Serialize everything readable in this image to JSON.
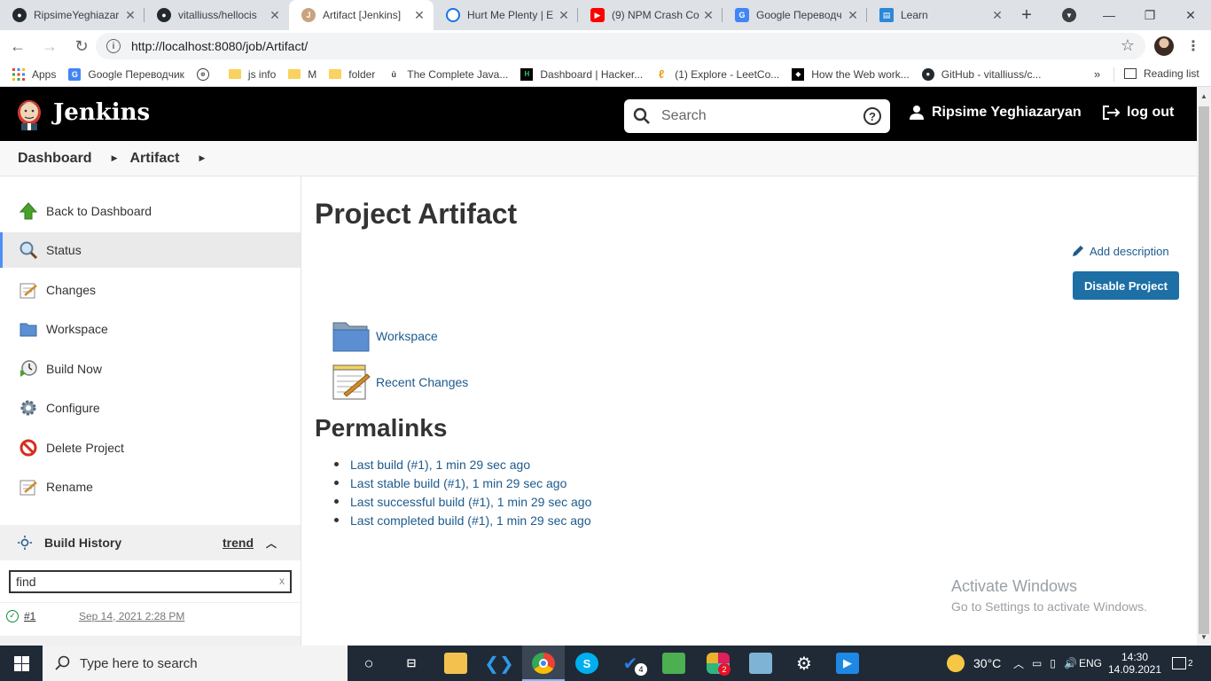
{
  "browser": {
    "tabs": [
      {
        "title": "RipsimeYeghiazar",
        "icon": "github-icon",
        "active": false
      },
      {
        "title": "vitalliuss/hellocis",
        "icon": "github-icon",
        "active": false
      },
      {
        "title": "Artifact [Jenkins]",
        "icon": "jenkins-icon",
        "active": true
      },
      {
        "title": "Hurt Me Plenty | E",
        "icon": "circle-icon",
        "active": false
      },
      {
        "title": "(9) NPM Crash Co",
        "icon": "youtube-icon",
        "active": false
      },
      {
        "title": "Google Переводч",
        "icon": "translate-icon",
        "active": false
      },
      {
        "title": "Learn",
        "icon": "book-icon",
        "active": false
      }
    ],
    "url": "http://localhost:8080/job/Artifact/",
    "bookmarks": [
      {
        "label": "Apps",
        "icon": "apps-grid-icon"
      },
      {
        "label": "Google Переводчик",
        "icon": "translate-icon"
      },
      {
        "label": "",
        "icon": "globe-icon"
      },
      {
        "label": "js info",
        "icon": "folder-icon"
      },
      {
        "label": "M",
        "icon": "folder-icon"
      },
      {
        "label": "folder",
        "icon": "folder-icon"
      },
      {
        "label": "The Complete Java...",
        "icon": "udemy-icon"
      },
      {
        "label": "Dashboard | Hacker...",
        "icon": "hackerrank-icon"
      },
      {
        "label": "(1) Explore - LeetCo...",
        "icon": "leetcode-icon"
      },
      {
        "label": "How the Web work...",
        "icon": "web-icon"
      },
      {
        "label": "GitHub - vitalliuss/c...",
        "icon": "github-icon"
      }
    ],
    "bookmarks_more": "»",
    "reading_list": "Reading list"
  },
  "jenkins": {
    "brand": "Jenkins",
    "search_placeholder": "Search",
    "help": "?",
    "user": "Ripsime Yeghiazaryan",
    "logout": "log out",
    "breadcrumb": [
      "Dashboard",
      "Artifact"
    ],
    "tasks": [
      {
        "label": "Back to Dashboard",
        "icon": "up-arrow-icon"
      },
      {
        "label": "Status",
        "icon": "magnifier-icon"
      },
      {
        "label": "Changes",
        "icon": "notepad-icon"
      },
      {
        "label": "Workspace",
        "icon": "folder-icon"
      },
      {
        "label": "Build Now",
        "icon": "clock-play-icon"
      },
      {
        "label": "Configure",
        "icon": "gear-icon"
      },
      {
        "label": "Delete Project",
        "icon": "no-entry-icon"
      },
      {
        "label": "Rename",
        "icon": "notepad-icon"
      }
    ],
    "build_history": {
      "title": "Build History",
      "trend": "trend",
      "find_placeholder": "find",
      "clear": "x",
      "builds": [
        {
          "number": "#1",
          "date": "Sep 14, 2021 2:28 PM",
          "status": "success"
        }
      ]
    },
    "main": {
      "title": "Project Artifact",
      "add_description": "Add description",
      "disable_button": "Disable Project",
      "links": [
        {
          "label": "Workspace",
          "icon": "folder-icon"
        },
        {
          "label": "Recent Changes",
          "icon": "notepad-icon"
        }
      ],
      "permalinks_title": "Permalinks",
      "permalinks": [
        "Last build (#1), 1 min 29 sec ago",
        "Last stable build (#1), 1 min 29 sec ago",
        "Last successful build (#1), 1 min 29 sec ago",
        "Last completed build (#1), 1 min 29 sec ago"
      ]
    },
    "watermark": {
      "line1": "Activate Windows",
      "line2": "Go to Settings to activate Windows."
    }
  },
  "taskbar": {
    "search_placeholder": "Type here to search",
    "weather": "30°C",
    "language": "ENG",
    "time": "14:30",
    "date": "14.09.2021",
    "notifications": "2",
    "badges": {
      "todo": "4",
      "slack": "2"
    }
  },
  "colors": {
    "jenkins_header": "#000000",
    "link": "#1d5a8c",
    "primary_button": "#1d6fa5",
    "active_task_bar": "#4e8ef7",
    "taskbar": "#1f2a36"
  }
}
